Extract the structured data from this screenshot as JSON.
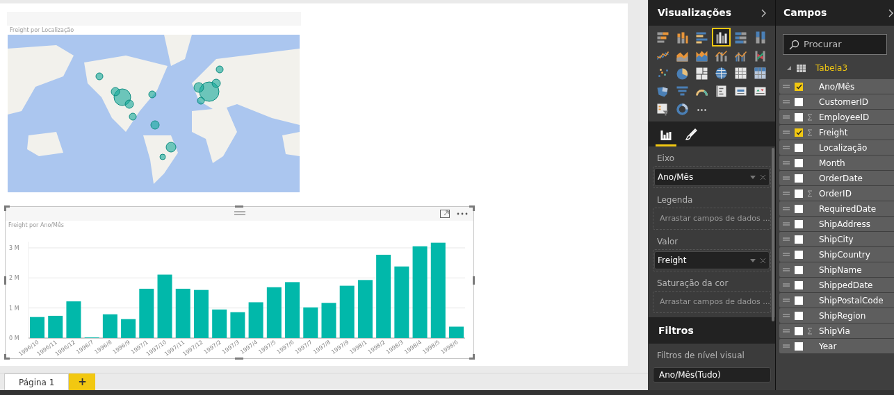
{
  "report": {
    "visuals": [
      {
        "kind": "map",
        "title": "Freight por Localização",
        "selected": false
      },
      {
        "kind": "column_chart",
        "selected": true,
        "chart_data": {
          "type": "bar",
          "title": "Freight por Ano/Mês",
          "grid": true,
          "categories": [
            "1996/10",
            "1996/11",
            "1996/12",
            "1996/7",
            "1996/8",
            "1996/9",
            "1997/1",
            "1997/10",
            "1997/11",
            "1997/12",
            "1997/2",
            "1997/3",
            "1997/4",
            "1997/5",
            "1997/6",
            "1997/7",
            "1997/8",
            "1997/9",
            "1998/1",
            "1998/2",
            "1998/3",
            "1998/4",
            "1998/5",
            "1998/6"
          ],
          "series": [
            {
              "color": "#01b8aa",
              "values": [
                0.7,
                0.74,
                1.22,
                0.02,
                0.79,
                0.63,
                1.64,
                2.11,
                1.64,
                1.6,
                0.95,
                0.86,
                1.19,
                1.69,
                1.86,
                1.02,
                1.17,
                1.74,
                1.93,
                2.77,
                2.38,
                3.05,
                3.17,
                0.38
              ]
            }
          ],
          "ylim": [
            0,
            3.2
          ],
          "yticks": [
            {
              "value": 0,
              "label": "0 M"
            },
            {
              "value": 1,
              "label": "1 M"
            },
            {
              "value": 2,
              "label": "2 M"
            },
            {
              "value": 3,
              "label": "3 M"
            }
          ]
        }
      }
    ],
    "page_tabs": [
      {
        "label": "Página 1",
        "selected": true
      }
    ],
    "add_page": "+"
  },
  "visualizations": {
    "title": "Visualizações",
    "types": [
      {
        "kind": "stacked-bar",
        "selected": false
      },
      {
        "kind": "stacked-column",
        "selected": false
      },
      {
        "kind": "clustered-bar",
        "selected": false
      },
      {
        "kind": "clustered-column",
        "selected": true
      },
      {
        "kind": "percent-bar",
        "selected": false
      },
      {
        "kind": "percent-column",
        "selected": false
      },
      {
        "kind": "line",
        "selected": false
      },
      {
        "kind": "area",
        "selected": false
      },
      {
        "kind": "stacked-area",
        "selected": false
      },
      {
        "kind": "line-column",
        "selected": false
      },
      {
        "kind": "line-clustered",
        "selected": false
      },
      {
        "kind": "ribbon",
        "selected": false
      },
      {
        "kind": "scatter",
        "selected": false
      },
      {
        "kind": "pie",
        "selected": false
      },
      {
        "kind": "treemap",
        "selected": false
      },
      {
        "kind": "globe",
        "selected": false
      },
      {
        "kind": "table",
        "selected": false
      },
      {
        "kind": "matrix",
        "selected": false
      },
      {
        "kind": "filled-map",
        "selected": false
      },
      {
        "kind": "funnel",
        "selected": false
      },
      {
        "kind": "gauge",
        "selected": false
      },
      {
        "kind": "multi-card",
        "selected": false
      },
      {
        "kind": "card",
        "selected": false
      },
      {
        "kind": "kpi",
        "selected": false
      },
      {
        "kind": "slicer",
        "selected": false
      },
      {
        "kind": "donut",
        "selected": false
      },
      {
        "kind": "more",
        "selected": false
      }
    ],
    "panes": [
      {
        "kind": "fields",
        "selected": true
      },
      {
        "kind": "format",
        "selected": false
      }
    ],
    "wells": [
      {
        "label": "Eixo",
        "field": "Ano/Mês"
      },
      {
        "label": "Legenda",
        "placeholder": "Arrastar campos de dados ..."
      },
      {
        "label": "Valor",
        "field": "Freight"
      },
      {
        "label": "Saturação da cor",
        "placeholder": "Arrastar campos de dados ..."
      }
    ]
  },
  "filters": {
    "title": "Filtros",
    "section": "Filtros de nível visual",
    "items": [
      "Ano/Mês(Tudo)"
    ]
  },
  "fields": {
    "title": "Campos",
    "search": {
      "placeholder": "Procurar"
    },
    "table": {
      "name": "Tabela3",
      "expanded": true,
      "children": [
        {
          "name": "Ano/Mês",
          "checked": true,
          "measure": false
        },
        {
          "name": "CustomerID",
          "checked": false,
          "measure": false
        },
        {
          "name": "EmployeeID",
          "checked": false,
          "measure": true
        },
        {
          "name": "Freight",
          "checked": true,
          "measure": true
        },
        {
          "name": "Localização",
          "checked": false,
          "measure": false
        },
        {
          "name": "Month",
          "checked": false,
          "measure": false
        },
        {
          "name": "OrderDate",
          "checked": false,
          "measure": false
        },
        {
          "name": "OrderID",
          "checked": false,
          "measure": true
        },
        {
          "name": "RequiredDate",
          "checked": false,
          "measure": false
        },
        {
          "name": "ShipAddress",
          "checked": false,
          "measure": false
        },
        {
          "name": "ShipCity",
          "checked": false,
          "measure": false
        },
        {
          "name": "ShipCountry",
          "checked": false,
          "measure": false
        },
        {
          "name": "ShipName",
          "checked": false,
          "measure": false
        },
        {
          "name": "ShippedDate",
          "checked": false,
          "measure": false
        },
        {
          "name": "ShipPostalCode",
          "checked": false,
          "measure": false
        },
        {
          "name": "ShipRegion",
          "checked": false,
          "measure": false
        },
        {
          "name": "ShipVia",
          "checked": false,
          "measure": true
        },
        {
          "name": "Year",
          "checked": false,
          "measure": false
        }
      ]
    }
  }
}
